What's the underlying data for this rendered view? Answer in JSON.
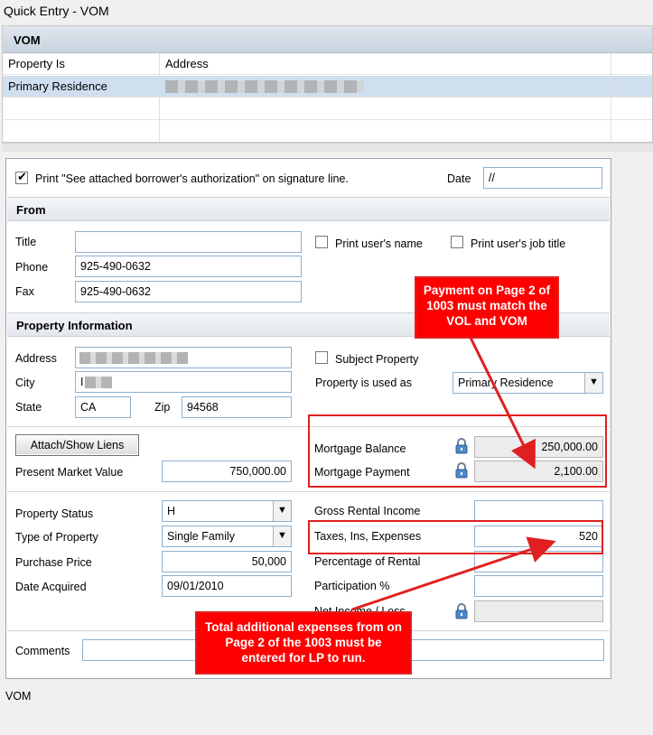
{
  "window": {
    "title": "Quick Entry - VOM"
  },
  "vom_list": {
    "header": "VOM",
    "columns": [
      "Property Is",
      "Address"
    ],
    "rows": [
      {
        "property_is": "Primary Residence"
      }
    ]
  },
  "auth": {
    "checkbox_label": "Print \"See attached borrower's authorization\" on signature line.",
    "checked": true,
    "date_label": "Date",
    "date_value": "//"
  },
  "from": {
    "heading": "From",
    "title_label": "Title",
    "title_value": "",
    "phone_label": "Phone",
    "phone_value": "925-490-0632",
    "fax_label": "Fax",
    "fax_value": "925-490-0632",
    "print_name_label": "Print user's name",
    "print_job_label": "Print user's job title"
  },
  "property": {
    "heading": "Property Information",
    "address_label": "Address",
    "city_label": "City",
    "city_value": "I",
    "state_label": "State",
    "state_value": "CA",
    "zip_label": "Zip",
    "zip_value": "94568",
    "subject_label": "Subject Property",
    "used_as_label": "Property is used as",
    "used_as_value": "Primary Residence"
  },
  "liens": {
    "attach_button": "Attach/Show Liens",
    "market_value_label": "Present Market Value",
    "market_value": "750,000.00",
    "mortgage_balance_label": "Mortgage Balance",
    "mortgage_balance": "250,000.00",
    "mortgage_payment_label": "Mortgage Payment",
    "mortgage_payment": "2,100.00"
  },
  "status": {
    "property_status_label": "Property Status",
    "property_status_value": "H",
    "type_label": "Type of Property",
    "type_value": "Single Family",
    "purchase_price_label": "Purchase Price",
    "purchase_price": "50,000",
    "date_acquired_label": "Date Acquired",
    "date_acquired": "09/01/2010"
  },
  "rental": {
    "gross_label": "Gross Rental Income",
    "gross_value": "",
    "taxes_label": "Taxes, Ins, Expenses",
    "taxes_value": "520",
    "percentage_label": "Percentage of Rental",
    "participation_label": "Participation %",
    "net_income_label": "Net Income / Loss"
  },
  "comments": {
    "label": "Comments",
    "value": ""
  },
  "footer": {
    "status": "VOM"
  },
  "annotations": {
    "callout_top": "Payment on Page 2 of 1003 must match the VOL and VOM",
    "callout_bottom": "Total additional expenses from on Page 2 of the 1003 must be entered for LP to run."
  },
  "colors": {
    "annotation_red": "#e02020",
    "selection_blue": "#cfdff0",
    "input_border": "#8fb0d0"
  },
  "icons": [
    "lock-icon",
    "checkbox-icon",
    "dropdown-arrow-icon"
  ]
}
